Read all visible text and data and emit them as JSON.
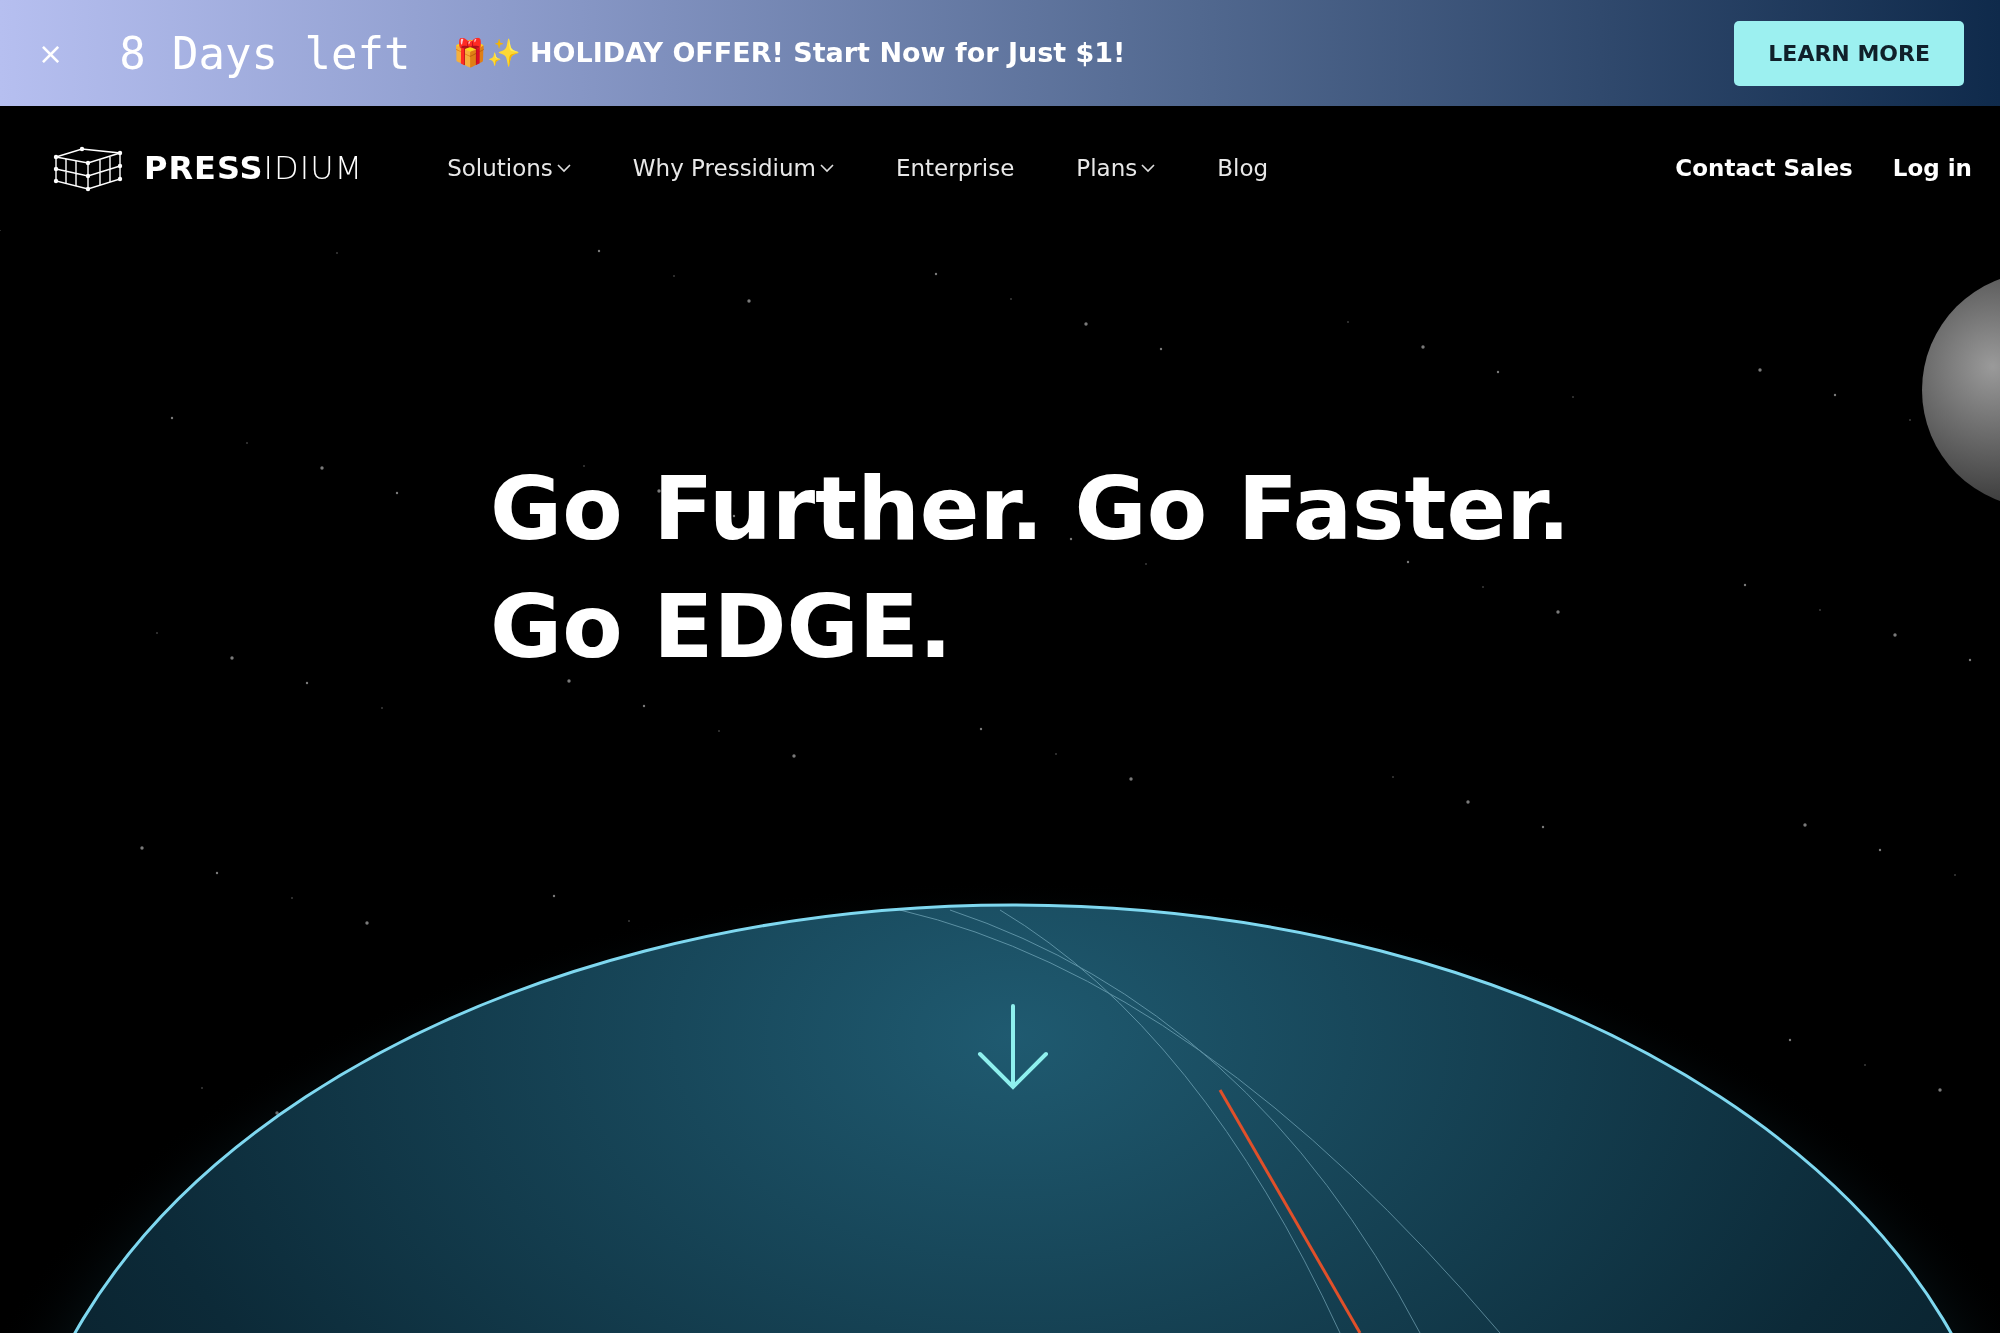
{
  "banner": {
    "close": "×",
    "countdown": "8 Days left",
    "offer": "🎁✨ HOLIDAY OFFER! Start Now for Just $1!",
    "button": "LEARN MORE"
  },
  "nav": {
    "brand_bold": "PRESS",
    "brand_light": "IDIUM",
    "items": [
      {
        "label": "Solutions",
        "kind": "dropdown"
      },
      {
        "label": "Why Pressidium",
        "kind": "dropdown"
      },
      {
        "label": "Enterprise",
        "kind": "link"
      },
      {
        "label": "Plans",
        "kind": "dropdown"
      },
      {
        "label": "Blog",
        "kind": "link"
      }
    ],
    "actions": [
      "Contact Sales",
      "Log in"
    ]
  },
  "hero": {
    "headline": [
      "Go Further. Go Faster.",
      "Go EDGE."
    ]
  }
}
